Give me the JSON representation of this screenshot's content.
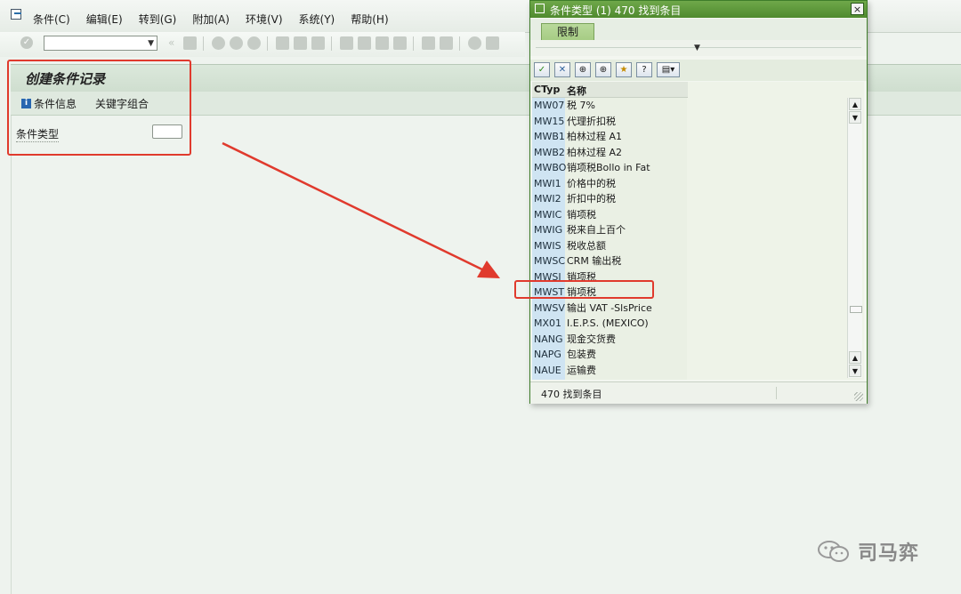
{
  "menubar": {
    "items": [
      {
        "label": "条件(C)"
      },
      {
        "label": "编辑(E)"
      },
      {
        "label": "转到(G)"
      },
      {
        "label": "附加(A)"
      },
      {
        "label": "环境(V)"
      },
      {
        "label": "系统(Y)"
      },
      {
        "label": "帮助(H)"
      }
    ]
  },
  "toolbar": {
    "command_value": ""
  },
  "screen": {
    "title": "创建条件记录",
    "condition_info_label": "条件信息",
    "key_combination_label": "关键字组合",
    "condition_type_label": "条件类型",
    "condition_type_value": ""
  },
  "dialog": {
    "title": "条件类型 (1)  470 找到条目",
    "close_label": "×",
    "tab_label": "限制",
    "col_ctyp": "CTyp",
    "col_name": "名称",
    "rows": [
      {
        "code": "MW07",
        "name": "税 7%"
      },
      {
        "code": "MW15",
        "name": "代理折扣税"
      },
      {
        "code": "MWB1",
        "name": "柏林过程 A1"
      },
      {
        "code": "MWB2",
        "name": "柏林过程 A2"
      },
      {
        "code": "MWBO",
        "name": "销项税Bollo in Fat"
      },
      {
        "code": "MWI1",
        "name": "价格中的税"
      },
      {
        "code": "MWI2",
        "name": "折扣中的税"
      },
      {
        "code": "MWIC",
        "name": "销项税"
      },
      {
        "code": "MWIG",
        "name": "税来自上百个"
      },
      {
        "code": "MWIS",
        "name": "税收总额"
      },
      {
        "code": "MWSC",
        "name": "CRM 输出税"
      },
      {
        "code": "MWSI",
        "name": "销项税"
      },
      {
        "code": "MWST",
        "name": "销项税"
      },
      {
        "code": "MWSV",
        "name": "输出 VAT -SlsPrice"
      },
      {
        "code": "MX01",
        "name": "I.E.P.S. (MEXICO)"
      },
      {
        "code": "NANG",
        "name": "现金交货费"
      },
      {
        "code": "NAPG",
        "name": "包装费"
      },
      {
        "code": "NAUE",
        "name": "运输费"
      }
    ],
    "status_text": "470 找到条目"
  },
  "watermark": {
    "text": "司马弈"
  },
  "colors": {
    "highlight_red": "#e03a2d",
    "dialog_header": "#4f8a2e",
    "code_column": "#cfe4f2"
  }
}
